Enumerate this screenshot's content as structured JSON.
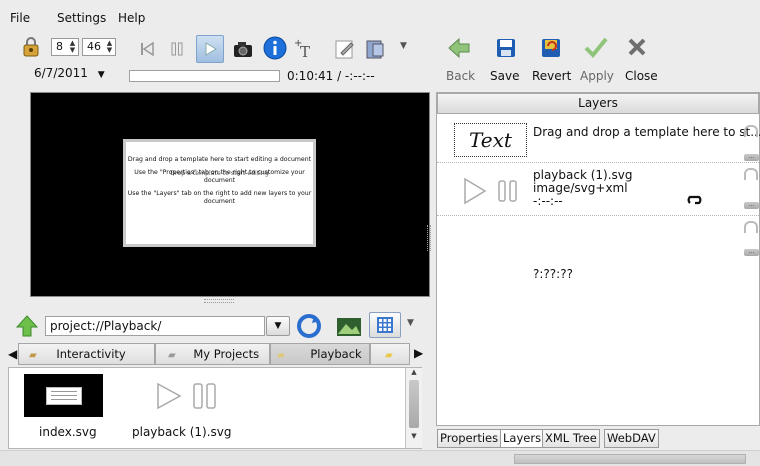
{
  "menu": {
    "file": "File",
    "settings": "Settings",
    "help": "Help"
  },
  "player": {
    "spin_left": "8",
    "spin_right": "46",
    "date": "6/7/2011",
    "time": "0:10:41 / -:--:--",
    "progress": 0.0
  },
  "editor_toolbar": {
    "back": "Back",
    "save": "Save",
    "revert": "Revert",
    "apply": "Apply",
    "close": "Close"
  },
  "preview_card": {
    "line1": "Drag and drop a template here to start editing a document",
    "line2": "Use the \"Properties\" tab on the right to customize your document",
    "line2_overlap": "Drop a template to start editing",
    "line3": "Use the \"Layers\" tab on the right to add new layers to your document"
  },
  "layers": {
    "header": "Layers",
    "rows": [
      {
        "badge": "Text",
        "description": "Drag and drop a template here to st..."
      },
      {
        "name": "playback (1).svg",
        "mime": "image/svg+xml",
        "time": "-:--:--"
      },
      {
        "time": "?:??:??"
      }
    ]
  },
  "browser": {
    "path": "project://Playback/",
    "tabs": [
      "Interactivity",
      "My Projects",
      "Playback"
    ],
    "files": [
      {
        "name": "index.svg"
      },
      {
        "name": "playback (1).svg"
      }
    ]
  },
  "bottom_tabs": [
    "Properties",
    "Layers",
    "XML Tree",
    "WebDAV"
  ],
  "colors": {
    "play_active": "#4a86c5",
    "info_blue": "#1d6fd9",
    "green_arrow": "#3a9a2a",
    "black": "#000000"
  }
}
